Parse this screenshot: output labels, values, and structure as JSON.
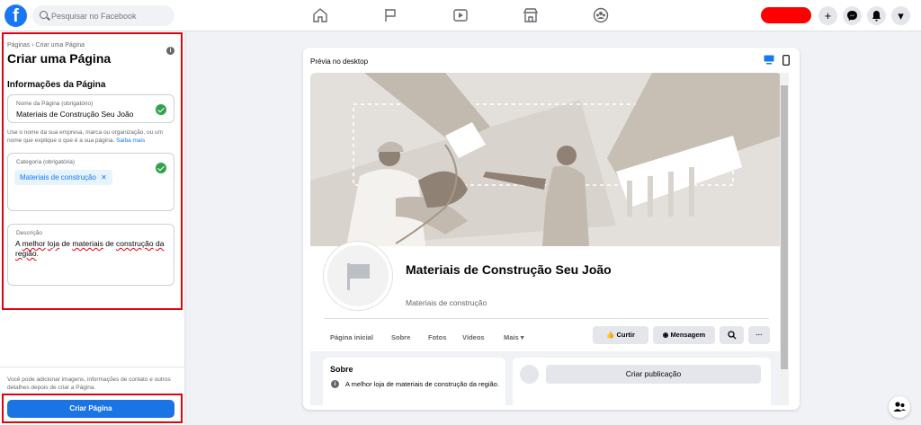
{
  "topbar": {
    "logo": "f",
    "search_placeholder": "Pesquisar no Facebook",
    "nav_icons": [
      "home-icon",
      "flag-icon",
      "video-icon",
      "marketplace-icon",
      "groups-icon"
    ],
    "right_icons": [
      "plus-icon",
      "messenger-icon",
      "notifications-icon",
      "chevron-down-icon"
    ],
    "plus": "+",
    "chevron": "▾"
  },
  "left": {
    "breadcrumb": "Páginas › Criar uma Página",
    "title": "Criar uma Página",
    "info": "i",
    "section": "Informações da Página",
    "name_field": {
      "label": "Nome da Página (obrigatório)",
      "value": "Materiais de Construção Seu João"
    },
    "hint": "Use o nome da sua empresa, marca ou organização, ou um nome que explique o que é a sua página.",
    "hint_link": "Saiba mais",
    "category_field": {
      "label": "Categoria (obrigatória)",
      "chip": "Materiais de construção",
      "chip_close": "✕"
    },
    "description_field": {
      "label": "Descrição",
      "w1": "A ",
      "w2": "melhor",
      "w3": " ",
      "w4": "loja",
      "w5": " de ",
      "w6": "materiais",
      "w7": " de ",
      "w8": "construção",
      "w9": " ",
      "w10": "da região",
      "w11": "."
    },
    "bottom_note": "Você pode adicionar imagens, informações de contato e outros detalhes depois de criar a Página.",
    "create_button": "Criar Página"
  },
  "preview": {
    "title": "Prévia no desktop",
    "page_name": "Materiais de Construção Seu João",
    "category": "Materiais de construção",
    "tabs": [
      "Página inicial",
      "Sobre",
      "Fotos",
      "Vídeos",
      "Mais ▾"
    ],
    "actions": {
      "like": "Curtir",
      "message": "Mensagem"
    },
    "about": {
      "title": "Sobre",
      "text": "A melhor loja de materiais de construção da região.",
      "icon": "i"
    },
    "post_button": "Criar publicação"
  },
  "colors": {
    "brand": "#1877f2",
    "highlight": "#e3000f",
    "success": "#31a24c"
  }
}
